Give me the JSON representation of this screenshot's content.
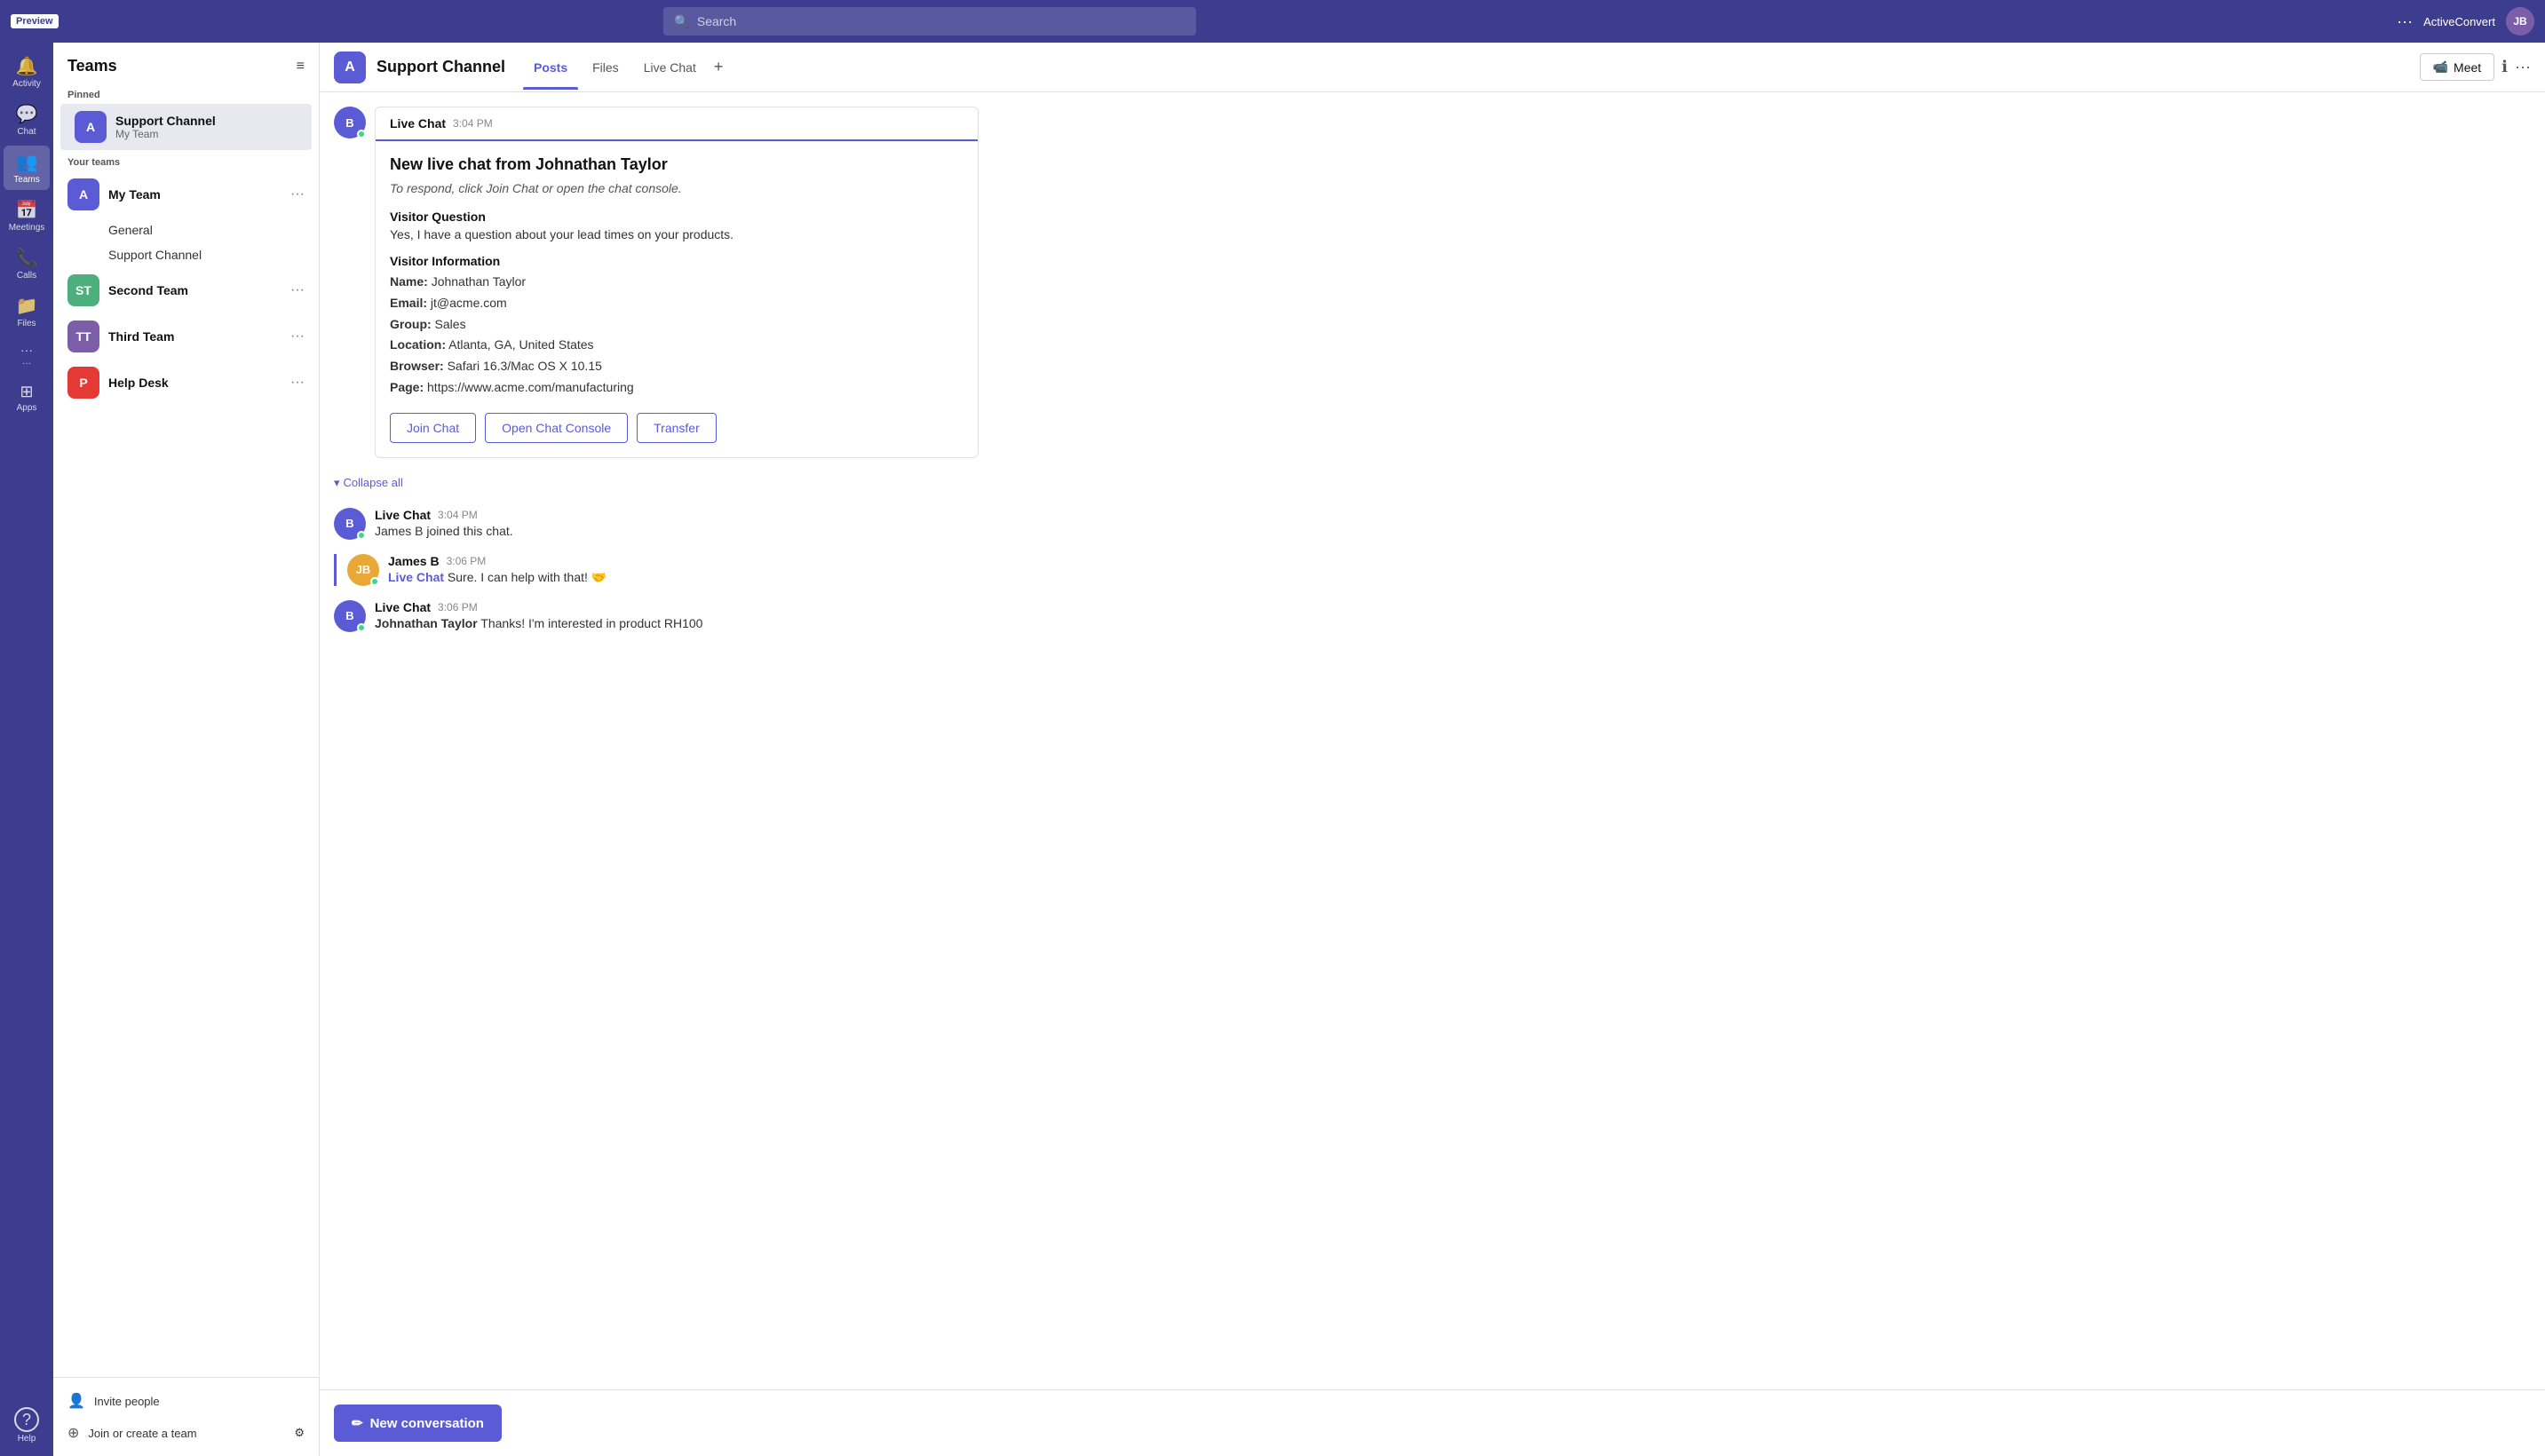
{
  "topbar": {
    "preview_label": "Preview",
    "search_placeholder": "Search",
    "dots_label": "···",
    "username": "ActiveConvert",
    "avatar_initials": "JB"
  },
  "nav": {
    "items": [
      {
        "id": "activity",
        "label": "Activity",
        "icon": "🔔",
        "active": false
      },
      {
        "id": "chat",
        "label": "Chat",
        "icon": "💬",
        "active": false
      },
      {
        "id": "teams",
        "label": "Teams",
        "icon": "👥",
        "active": true
      },
      {
        "id": "meetings",
        "label": "Meetings",
        "icon": "📅",
        "active": false
      },
      {
        "id": "calls",
        "label": "Calls",
        "icon": "📞",
        "active": false
      },
      {
        "id": "files",
        "label": "Files",
        "icon": "📁",
        "active": false
      },
      {
        "id": "more",
        "label": "···",
        "icon": "···",
        "active": false
      },
      {
        "id": "apps",
        "label": "Apps",
        "icon": "⊞",
        "active": false
      }
    ],
    "bottom": {
      "id": "help",
      "label": "Help",
      "icon": "?"
    }
  },
  "sidebar": {
    "title": "Teams",
    "pinned_label": "Pinned",
    "pinned_item": {
      "initial": "A",
      "bg": "#5b5bd6",
      "name": "Support Channel",
      "sub": "My Team"
    },
    "your_teams_label": "Your teams",
    "teams": [
      {
        "id": "my-team",
        "initial": "A",
        "bg": "#5b5bd6",
        "name": "My Team",
        "channels": [
          "General",
          "Support Channel"
        ]
      },
      {
        "id": "second-team",
        "initial": "ST",
        "bg": "#4caf7d",
        "name": "Second Team",
        "channels": []
      },
      {
        "id": "third-team",
        "initial": "TT",
        "bg": "#7b5ea7",
        "name": "Third Team",
        "channels": []
      },
      {
        "id": "help-desk",
        "initial": "P",
        "bg": "#e53935",
        "name": "Help Desk",
        "channels": []
      }
    ],
    "bottom": {
      "invite_label": "Invite people",
      "join_label": "Join or create a team"
    }
  },
  "channel": {
    "avatar_initial": "A",
    "avatar_bg": "#5b5bd6",
    "name": "Support Channel",
    "tabs": [
      "Posts",
      "Files",
      "Live Chat"
    ],
    "active_tab": "Posts",
    "meet_label": "Meet",
    "header_icon_info": "ℹ",
    "header_icon_more": "···"
  },
  "messages": {
    "collapse_all_label": "Collapse all",
    "live_chat_card": {
      "label": "Live Chat",
      "time": "3:04 PM",
      "headline": "New live chat from Johnathan Taylor",
      "subtext": "To respond, click Join Chat or open the chat console.",
      "visitor_question_title": "Visitor Question",
      "visitor_question_text": "Yes, I have a question about your lead times on your products.",
      "visitor_info_title": "Visitor Information",
      "name_label": "Name:",
      "name_value": "Johnathan Taylor",
      "email_label": "Email:",
      "email_value": "jt@acme.com",
      "group_label": "Group:",
      "group_value": "Sales",
      "location_label": "Location:",
      "location_value": "Atlanta, GA, United States",
      "browser_label": "Browser:",
      "browser_value": "Safari 16.3/Mac OS X 10.15",
      "page_label": "Page:",
      "page_value": "https://www.acme.com/manufacturing",
      "join_chat_label": "Join Chat",
      "open_console_label": "Open Chat Console",
      "transfer_label": "Transfer"
    },
    "chat_messages": [
      {
        "id": "msg1",
        "avatar_initial": "B",
        "avatar_bg": "#5b5bd6",
        "sender": "Live Chat",
        "time": "3:04 PM",
        "text": "James B joined this chat.",
        "type": "system",
        "accent": false
      },
      {
        "id": "msg2",
        "avatar_initial": "JB",
        "avatar_bg": "#e8a838",
        "sender": "James B",
        "time": "3:06 PM",
        "text": "Sure.  I can help with that! 🤝",
        "tag": "Live Chat",
        "type": "user",
        "accent": true
      },
      {
        "id": "msg3",
        "avatar_initial": "B",
        "avatar_bg": "#5b5bd6",
        "sender": "Live Chat",
        "time": "3:06 PM",
        "sender_bold": "Johnathan Taylor",
        "text": "Thanks! I'm interested in product RH100",
        "type": "visitor",
        "accent": false
      }
    ],
    "new_conv_label": "New conversation"
  }
}
